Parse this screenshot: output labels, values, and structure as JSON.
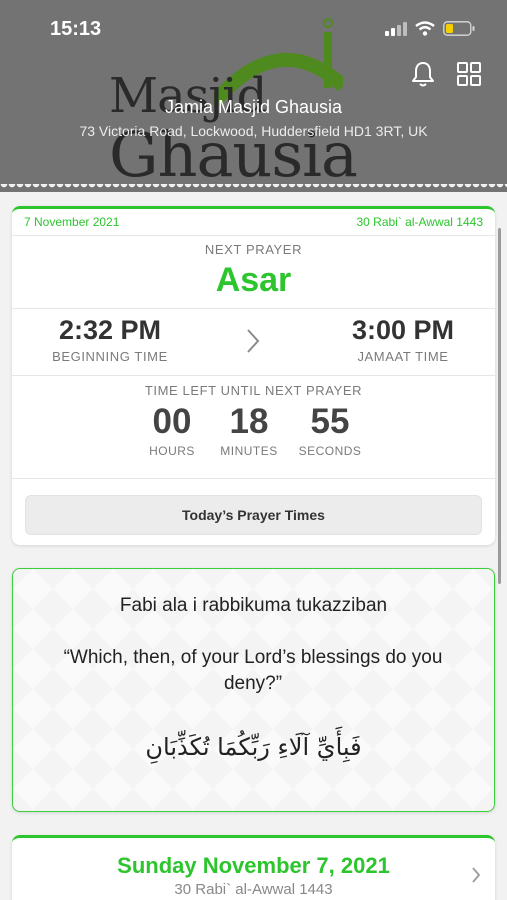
{
  "status_bar": {
    "time": "15:13"
  },
  "header": {
    "logo_word_1": "Masjid",
    "logo_word_2": "Ghausia",
    "mosque_name": "Jamia Masjid Ghausia",
    "address": "73 Victoria Road, Lockwood, Huddersfield HD1 3RT, UK"
  },
  "prayer_card": {
    "gregorian_date": "7 November 2021",
    "hijri_date": "30 Rabi` al-Awwal 1443",
    "next_prayer_label": "NEXT PRAYER",
    "next_prayer_name": "Asar",
    "beginning_time": "2:32 PM",
    "beginning_label": "BEGINNING TIME",
    "jamaat_time": "3:00 PM",
    "jamaat_label": "JAMAAT TIME",
    "time_left_label": "TIME LEFT UNTIL NEXT PRAYER",
    "countdown": {
      "hours": "00",
      "hours_label": "HOURS",
      "minutes": "18",
      "minutes_label": "MINUTES",
      "seconds": "55",
      "seconds_label": "SECONDS"
    },
    "today_button": "Today’s Prayer Times"
  },
  "verse_card": {
    "transliteration": "Fabi ala i rabbikuma tukazziban",
    "translation": "“Which, then, of your Lord’s blessings do you deny?”",
    "arabic": "فَبِأَيِّ آلَاءِ رَبِّكُمَا تُكَذِّبَانِ"
  },
  "day_card": {
    "title": "Sunday November 7, 2021",
    "hijri": "30 Rabi` al-Awwal 1443"
  },
  "colors": {
    "accent": "#2dc52d",
    "header_bg": "#737373",
    "logo_green": "#4f8a1f"
  },
  "icons": [
    "signal-icon",
    "wifi-icon",
    "battery-icon",
    "bell-icon",
    "grid-icon",
    "chevron-right-icon"
  ]
}
